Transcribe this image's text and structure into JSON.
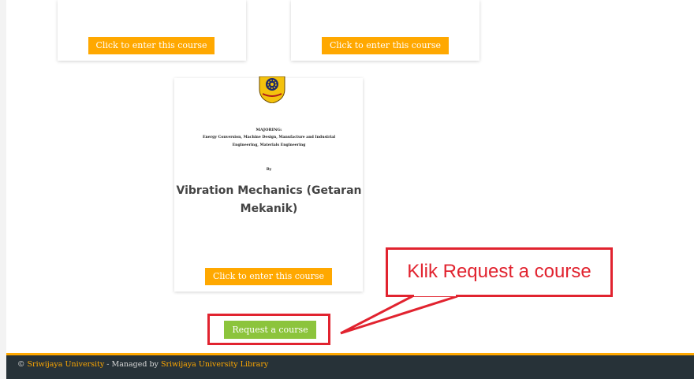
{
  "cards": {
    "top_left_button": "Click to enter this course",
    "top_right_button": "Click to enter this course",
    "course": {
      "majoring_label": "MAJORING:",
      "majoring_line1": "Energy Conversion, Machine Design, Manufacture and Industrial",
      "majoring_line2": "Engineering, Materials Engineering",
      "by_label": "By",
      "title": "Vibration Mechanics (Getaran Mekanik)",
      "button": "Click to enter this course"
    }
  },
  "request_button": "Request a course",
  "annotation": {
    "text": "Klik Request a course",
    "color": "#e1232f"
  },
  "footer": {
    "copyright_symbol": "©",
    "university": "Sriwijaya University",
    "separator": " - Managed by ",
    "library": "Sriwijaya University Library"
  },
  "colors": {
    "accent": "#ffa800",
    "request": "#8cc43c",
    "footer_bg": "#273238"
  }
}
